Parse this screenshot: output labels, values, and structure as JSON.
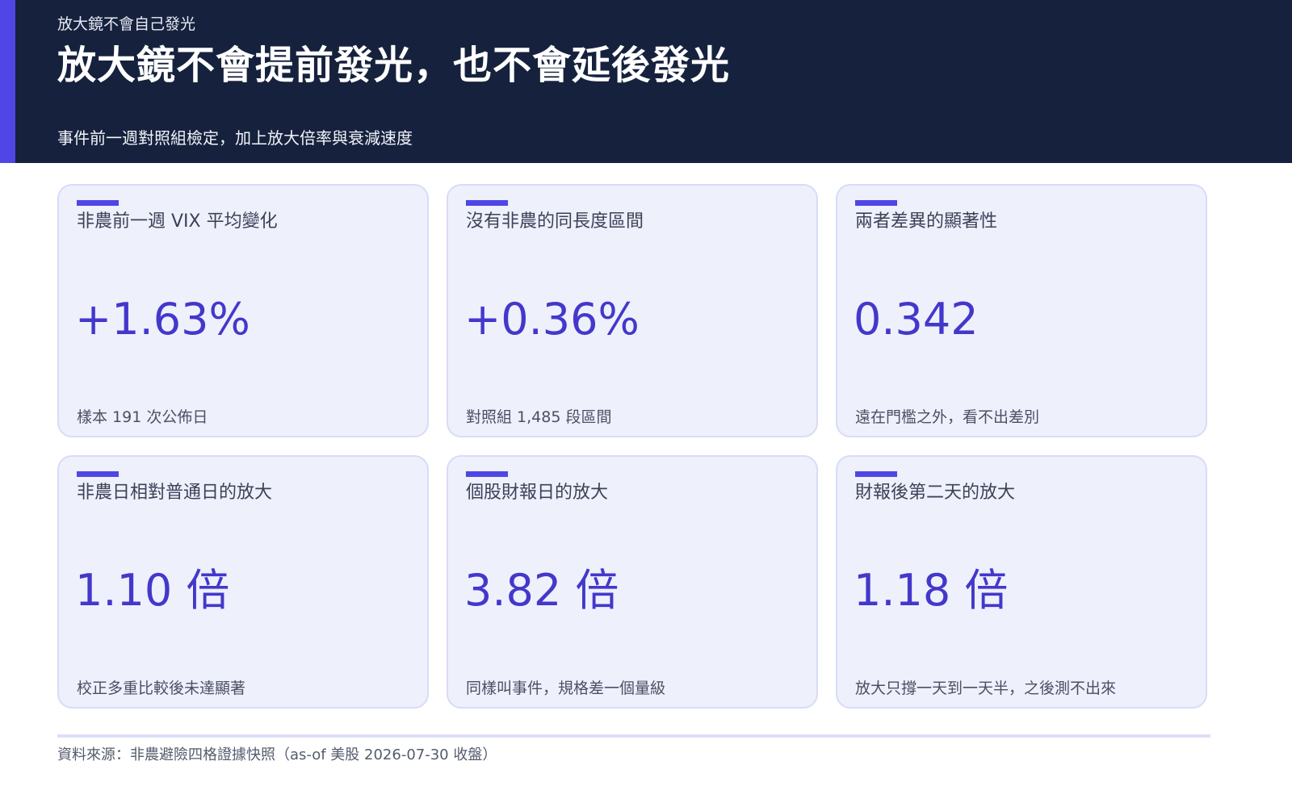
{
  "header": {
    "kicker": "放大鏡不會自己發光",
    "title": "放大鏡不會提前發光，也不會延後發光",
    "subtitle": "事件前一週對照組檢定，加上放大倍率與衰減速度"
  },
  "cards": [
    {
      "label": "非農前一週 VIX 平均變化",
      "value": "+1.63%",
      "note": "樣本 191 次公佈日"
    },
    {
      "label": "沒有非農的同長度區間",
      "value": "+0.36%",
      "note": "對照組 1,485 段區間"
    },
    {
      "label": "兩者差異的顯著性",
      "value": "0.342",
      "note": "遠在門檻之外，看不出差別"
    },
    {
      "label": "非農日相對普通日的放大",
      "value": "1.10 倍",
      "note": "校正多重比較後未達顯著"
    },
    {
      "label": "個股財報日的放大",
      "value": "3.82 倍",
      "note": "同樣叫事件，規格差一個量級"
    },
    {
      "label": "財報後第二天的放大",
      "value": "1.18 倍",
      "note": "放大只撐一天到一天半，之後測不出來"
    }
  ],
  "footer": {
    "source": "資料來源：非農避險四格證據快照（as-of 美股 2026-07-30 收盤）"
  },
  "colors": {
    "header_bg": "#16223d",
    "accent": "#4f46e5",
    "value_text": "#4338ca",
    "card_bg": "#eef0fc",
    "card_border": "#d8dcf6"
  }
}
